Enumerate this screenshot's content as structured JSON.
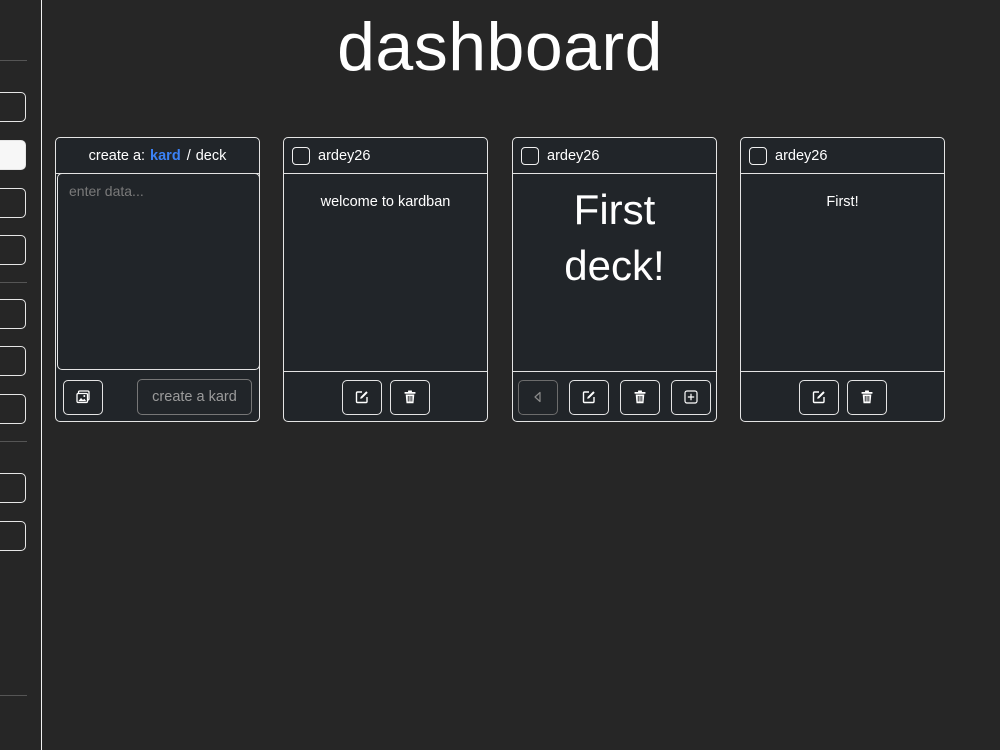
{
  "page": {
    "title": "dashboard"
  },
  "create_card": {
    "prefix": "create a:",
    "kard_label": "kard",
    "separator": "/",
    "deck_label": "deck",
    "textarea_placeholder": "enter data...",
    "image_button_icon": "image-icon",
    "create_button_label": "create a kard"
  },
  "cards": [
    {
      "user": "ardey26",
      "content": "welcome to kardban",
      "actions": [
        "edit-icon",
        "trash-icon"
      ]
    },
    {
      "user": "ardey26",
      "content": "First deck!",
      "actions": [
        "prev-icon",
        "edit-icon",
        "trash-icon",
        "plus-square-icon"
      ]
    },
    {
      "user": "ardey26",
      "content": "First!",
      "actions": [
        "edit-icon",
        "trash-icon"
      ]
    }
  ],
  "colors": {
    "background": "#262626",
    "card_background": "#212529",
    "accent": "#3b82f6",
    "border": "#e4e4e4"
  }
}
